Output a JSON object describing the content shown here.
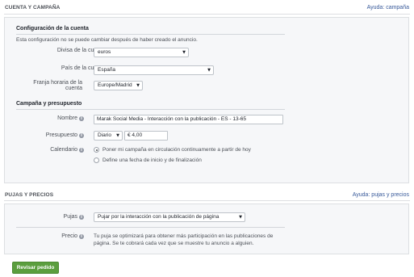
{
  "account_section": {
    "title": "CUENTA Y CAMPAÑA",
    "help_link": "Ayuda: campaña",
    "config": {
      "title": "Configuración de la cuenta",
      "note": "Esta configuración no se puede cambiar después de haber creado el anuncio.",
      "currency_label": "Divisa de la cuenta",
      "currency_value": "euros",
      "country_label": "País de la cuenta",
      "country_value": "España",
      "timezone_label_line1": "Franja horaria de la",
      "timezone_label_line2": "cuenta",
      "timezone_value": "Europe/Madrid"
    },
    "campaign": {
      "title": "Campaña y presupuesto",
      "name_label": "Nombre",
      "name_value": "Marak Social Media - Interacción con la publicación - ES - 13-65",
      "budget_label": "Presupuesto",
      "budget_period": "Diario",
      "budget_amount": "€ 4,00",
      "schedule_label": "Calendario",
      "schedule_options": [
        {
          "label": "Poner mi campaña en circulación continuamente a partir de hoy",
          "selected": true
        },
        {
          "label": "Define una fecha de inicio y de finalización",
          "selected": false
        }
      ]
    }
  },
  "bidding_section": {
    "title": "PUJAS Y PRECIOS",
    "help_link": "Ayuda: pujas y precios",
    "bid_label": "Pujas",
    "bid_value": "Pujar por la interacción con la publicación de página",
    "price_label": "Precio",
    "price_text_line1": "Tu puja se optimizará para obtener más participación en las publicaciones de",
    "price_text_line2": "página. Se te cobrará cada vez que se muestre tu anuncio a alguien."
  },
  "review_button": "Revisar pedido",
  "icons": {
    "info": "info-icon",
    "caret": "caret-down-icon"
  },
  "colors": {
    "link": "#365899",
    "button": "#5b9e3e",
    "panel": "#f6f7f9"
  }
}
